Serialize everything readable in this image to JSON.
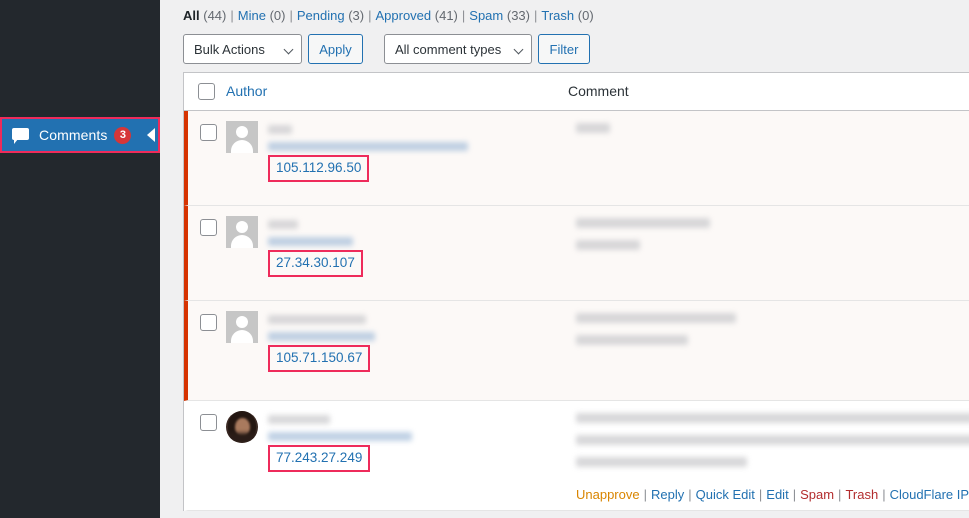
{
  "sidebar": {
    "menu_item": {
      "icon": "comment-bubble-icon",
      "label": "Comments",
      "badge_count": "3",
      "arrow": "collapse-arrow-icon"
    },
    "colors": {
      "background": "#23282d",
      "active_item": "#2271b1",
      "badge": "#d63638",
      "highlight_border": "#ee2b5b"
    }
  },
  "status_links": {
    "items": [
      {
        "label": "All",
        "count": "(44)",
        "current": true
      },
      {
        "label": "Mine",
        "count": "(0)",
        "current": false
      },
      {
        "label": "Pending",
        "count": "(3)",
        "current": false
      },
      {
        "label": "Approved",
        "count": "(41)",
        "current": false
      },
      {
        "label": "Spam",
        "count": "(33)",
        "current": false
      },
      {
        "label": "Trash",
        "count": "(0)",
        "current": false
      }
    ],
    "separator": "|"
  },
  "tablenav": {
    "bulk_actions_label": "Bulk Actions",
    "apply_label": "Apply",
    "comment_types_label": "All comment types",
    "filter_label": "Filter"
  },
  "table": {
    "columns": {
      "select_all": "select-all-checkbox",
      "author": "Author",
      "comment": "Comment"
    },
    "rows": [
      {
        "status": "unapproved",
        "avatar": "default-mystery-person-avatar",
        "author_name_redacted": true,
        "author_email_redacted": true,
        "ip_address": "105.112.96.50",
        "comment_redacted_lines": [
          48
        ],
        "show_actions": false
      },
      {
        "status": "unapproved",
        "avatar": "default-mystery-person-avatar",
        "author_name_redacted": true,
        "author_email_redacted": true,
        "ip_address": "27.34.30.107",
        "comment_redacted_lines": [
          222,
          96
        ],
        "show_actions": false
      },
      {
        "status": "unapproved",
        "avatar": "default-mystery-person-avatar",
        "author_name_redacted": true,
        "author_email_redacted": true,
        "ip_address": "105.71.150.67",
        "comment_redacted_lines": [
          250,
          163
        ],
        "show_actions": false
      },
      {
        "status": "approved",
        "avatar": "user-photo-avatar",
        "author_name_redacted": true,
        "author_email_redacted": true,
        "ip_address": "77.243.27.249",
        "comment_redacted_lines": [
          398,
          402,
          171
        ],
        "show_actions": true
      }
    ],
    "row_actions": {
      "unapprove": "Unapprove",
      "reply": "Reply",
      "quick_edit": "Quick Edit",
      "edit": "Edit",
      "spam": "Spam",
      "trash": "Trash",
      "cloudflare": "CloudFlare IP score",
      "separator": "|"
    }
  },
  "colors": {
    "link_blue": "#2271b1",
    "unapprove_orange": "#d98500",
    "destructive_red": "#b32d2e",
    "pending_stripe": "#d63301",
    "pending_row_bg": "#fcf9f7",
    "ip_highlight": "#ee2b5b"
  }
}
